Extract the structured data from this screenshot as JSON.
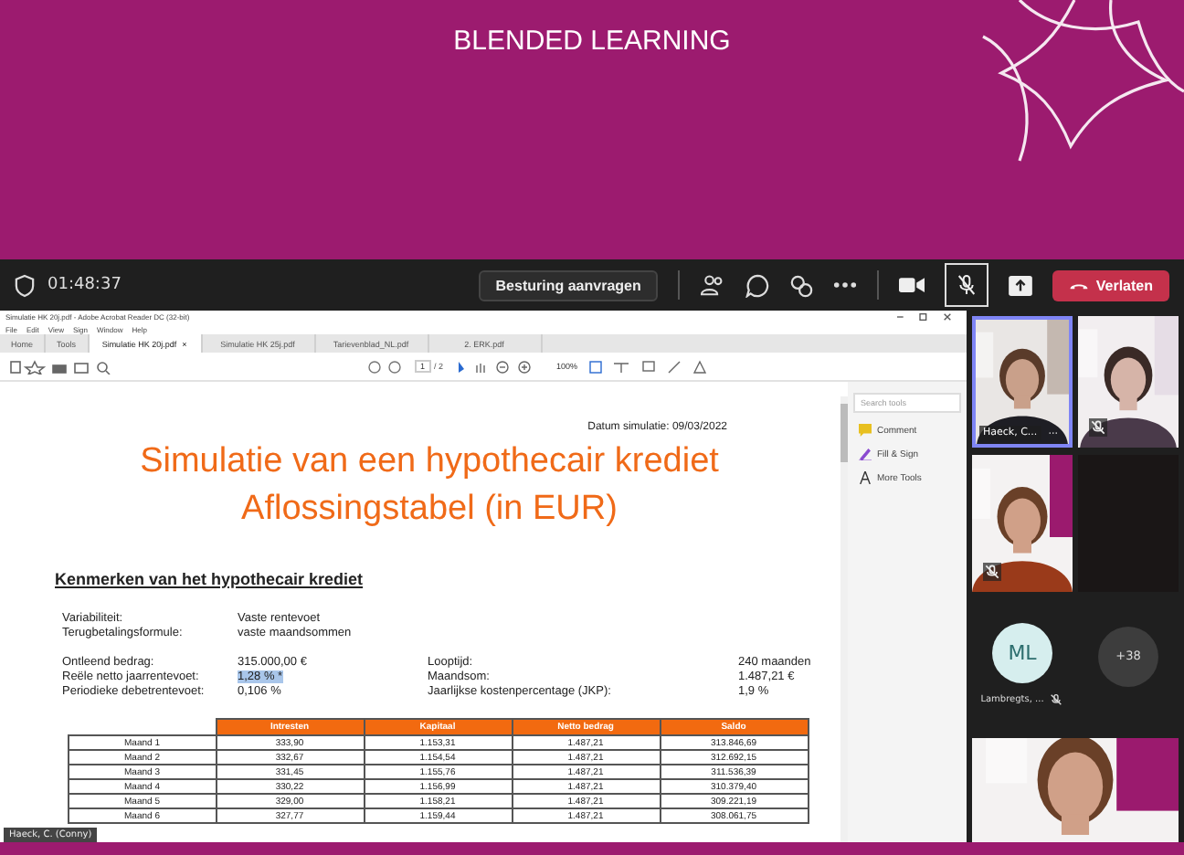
{
  "banner": {
    "title": "BLENDED LEARNING"
  },
  "meeting_bar": {
    "timer": "01:48:37",
    "request_control": "Besturing aanvragen",
    "mic_muted": true,
    "leave": "Verlaten"
  },
  "acrobat": {
    "title": "Simulatie HK 20j.pdf - Adobe Acrobat Reader DC (32-bit)",
    "menu": [
      "File",
      "Edit",
      "View",
      "Sign",
      "Window",
      "Help"
    ],
    "tabs": [
      {
        "label": "Home",
        "selected": false,
        "kind": "nav"
      },
      {
        "label": "Tools",
        "selected": false,
        "kind": "nav"
      },
      {
        "label": "Simulatie HK 20j.pdf",
        "selected": true,
        "kind": "file",
        "close": "×"
      },
      {
        "label": "Simulatie HK 25j.pdf",
        "selected": false,
        "kind": "file"
      },
      {
        "label": "Tarievenblad_NL.pdf",
        "selected": false,
        "kind": "file"
      },
      {
        "label": "2. ERK.pdf",
        "selected": false,
        "kind": "file"
      }
    ],
    "toolbar": {
      "page": "1",
      "pages": "/ 2",
      "zoom": "100%"
    },
    "tools_pane": {
      "placeholder": "Search tools",
      "items": [
        {
          "label": "Comment",
          "kind": "comment"
        },
        {
          "label": "Fill & Sign",
          "kind": "sign"
        },
        {
          "label": "More Tools",
          "kind": "more"
        }
      ]
    },
    "document": {
      "date": "Datum simulatie: 09/03/2022",
      "title_lines": [
        "Simulatie van een hypothecair krediet",
        "Aflossingstabel (in EUR)"
      ],
      "section": "Kenmerken van het hypothecair krediet",
      "details": [
        {
          "label": "Variabiliteit:",
          "value": "Vaste rentevoet"
        },
        {
          "label": "Terugbetalingsformule:",
          "value": "vaste maandsommen"
        }
      ],
      "loan": [
        {
          "label": "Ontleend bedrag:",
          "value": "315.000,00 €",
          "highlighted": false,
          "label_2": "Looptijd:",
          "value_2": "240 maanden"
        },
        {
          "label": "Reële netto jaarrentevoet:",
          "value": "1,28 % *",
          "highlighted": true,
          "label_2": "Maandsom:",
          "value_2": "1.487,21 €"
        },
        {
          "label": "Periodieke debetrentevoet:",
          "value": "0,106 %",
          "highlighted": false,
          "label_2": "Jaarlijkse kostenpercentage (JKP):",
          "value_2": "1,9 %"
        }
      ],
      "table": {
        "columns": [
          "",
          "Intresten",
          "Kapitaal",
          "Netto bedrag",
          "Saldo"
        ],
        "rows": [
          [
            "Maand 1",
            "333,90",
            "1.153,31",
            "1.487,21",
            "313.846,69"
          ],
          [
            "Maand 2",
            "332,67",
            "1.154,54",
            "1.487,21",
            "312.692,15"
          ],
          [
            "Maand 3",
            "331,45",
            "1.155,76",
            "1.487,21",
            "311.536,39"
          ],
          [
            "Maand 4",
            "330,22",
            "1.156,99",
            "1.487,21",
            "310.379,40"
          ],
          [
            "Maand 5",
            "329,00",
            "1.158,21",
            "1.487,21",
            "309.221,19"
          ],
          [
            "Maand 6",
            "327,77",
            "1.159,44",
            "1.487,21",
            "308.061,75"
          ]
        ]
      }
    }
  },
  "presenter_label": "Haeck, C. (Conny)",
  "participants": [
    {
      "kind": "video",
      "name": "Haeck, C...",
      "muted": false,
      "active": true,
      "more": "···"
    },
    {
      "kind": "video",
      "muted": true,
      "active": false
    },
    {
      "kind": "video",
      "muted": true,
      "active": false
    },
    {
      "kind": "empty"
    },
    {
      "kind": "avatar",
      "initials": "ML",
      "name": "Lambregts, ...",
      "muted": true
    },
    {
      "kind": "overflow",
      "count": "+38"
    },
    {
      "kind": "wide_video"
    }
  ]
}
